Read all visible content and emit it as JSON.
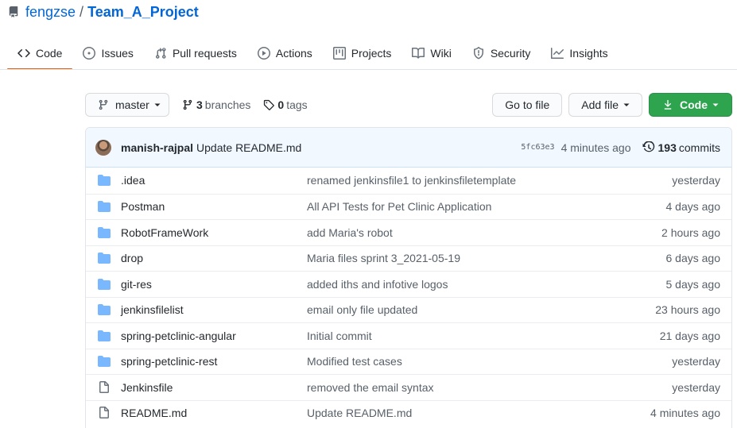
{
  "repo": {
    "owner": "fengzse",
    "separator": "/",
    "name": "Team_A_Project",
    "icon": "repo-icon"
  },
  "tabs": [
    {
      "label": "Code",
      "icon": "code-icon",
      "active": true
    },
    {
      "label": "Issues",
      "icon": "issue-icon"
    },
    {
      "label": "Pull requests",
      "icon": "pull-request-icon"
    },
    {
      "label": "Actions",
      "icon": "play-icon"
    },
    {
      "label": "Projects",
      "icon": "project-icon"
    },
    {
      "label": "Wiki",
      "icon": "book-icon"
    },
    {
      "label": "Security",
      "icon": "shield-icon"
    },
    {
      "label": "Insights",
      "icon": "graph-icon"
    }
  ],
  "toolbar": {
    "branch_label": "master",
    "branches_count": "3",
    "branches_label": "branches",
    "tags_count": "0",
    "tags_label": "tags",
    "goto_label": "Go to file",
    "addfile_label": "Add file",
    "code_label": "Code"
  },
  "latest_commit": {
    "author": "manish-rajpal",
    "message": "Update README.md",
    "sha": "5fc63e3",
    "ago": "4 minutes ago",
    "count": "193",
    "count_label": "commits"
  },
  "files": [
    {
      "type": "dir",
      "name": ".idea",
      "message": "renamed jenkinsfile1 to jenkinsfiletemplate",
      "age": "yesterday"
    },
    {
      "type": "dir",
      "name": "Postman",
      "message": "All API Tests for Pet Clinic Application",
      "age": "4 days ago"
    },
    {
      "type": "dir",
      "name": "RobotFrameWork",
      "message": "add Maria's robot",
      "age": "2 hours ago"
    },
    {
      "type": "dir",
      "name": "drop",
      "message": "Maria files sprint 3_2021-05-19",
      "age": "6 days ago"
    },
    {
      "type": "dir",
      "name": "git-res",
      "message": "added iths and infotive logos",
      "age": "5 days ago"
    },
    {
      "type": "dir",
      "name": "jenkinsfilelist",
      "message": "email only file updated",
      "age": "23 hours ago"
    },
    {
      "type": "dir",
      "name": "spring-petclinic-angular",
      "message": "Initial commit",
      "age": "21 days ago"
    },
    {
      "type": "dir",
      "name": "spring-petclinic-rest",
      "message": "Modified test cases",
      "age": "yesterday"
    },
    {
      "type": "file",
      "name": "Jenkinsfile",
      "message": "removed the email syntax",
      "age": "yesterday"
    },
    {
      "type": "file",
      "name": "README.md",
      "message": "Update README.md",
      "age": "4 minutes ago"
    }
  ],
  "colors": {
    "accent": "#0366d6",
    "folder": "#79b8ff",
    "tab_underline": "#e36209",
    "code_button": "#2ea44f",
    "commit_bar": "#f1f8ff"
  }
}
